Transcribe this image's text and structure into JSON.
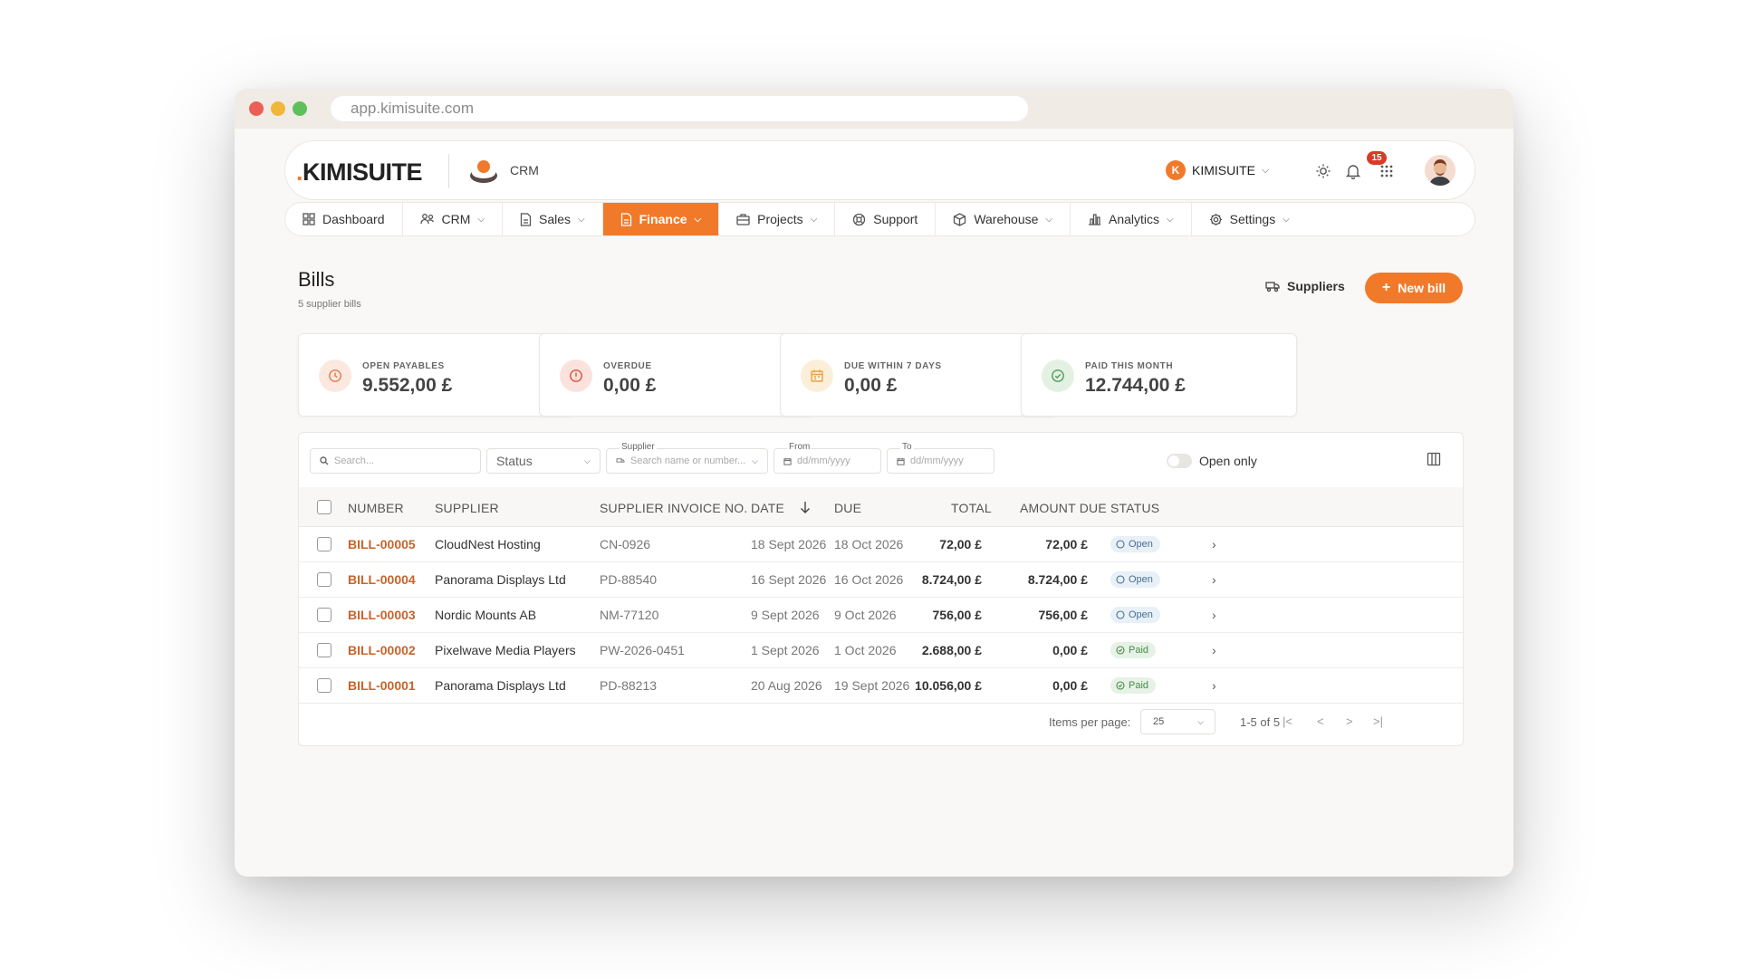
{
  "browser": {
    "url": "app.kimisuite.com"
  },
  "header": {
    "logo": "KIMISUITE",
    "module": "CRM",
    "tenant_initial": "K",
    "tenant": "KIMISUITE",
    "notifications_count": "15"
  },
  "nav": [
    {
      "label": "Dashboard",
      "icon": "dashboard-icon",
      "dropdown": false,
      "active": false
    },
    {
      "label": "CRM",
      "icon": "people-icon",
      "dropdown": true,
      "active": false
    },
    {
      "label": "Sales",
      "icon": "document-icon",
      "dropdown": true,
      "active": false
    },
    {
      "label": "Finance",
      "icon": "document-icon",
      "dropdown": true,
      "active": true
    },
    {
      "label": "Projects",
      "icon": "briefcase-icon",
      "dropdown": true,
      "active": false
    },
    {
      "label": "Support",
      "icon": "lifebuoy-icon",
      "dropdown": false,
      "active": false
    },
    {
      "label": "Warehouse",
      "icon": "box-icon",
      "dropdown": true,
      "active": false
    },
    {
      "label": "Analytics",
      "icon": "bar-chart-icon",
      "dropdown": true,
      "active": false
    },
    {
      "label": "Settings",
      "icon": "gear-icon",
      "dropdown": true,
      "active": false
    }
  ],
  "page": {
    "title": "Bills",
    "subtitle": "5 supplier bills",
    "suppliers_label": "Suppliers",
    "new_bill_label": "New bill"
  },
  "stats": [
    {
      "label": "OPEN PAYABLES",
      "value": "9.552,00 £",
      "icon": "clock-icon",
      "color": "#e5764a",
      "bg": "#fbe9df"
    },
    {
      "label": "OVERDUE",
      "value": "0,00 £",
      "icon": "alert-icon",
      "color": "#d9503c",
      "bg": "#fbe2dd"
    },
    {
      "label": "DUE WITHIN 7 DAYS",
      "value": "0,00 £",
      "icon": "calendar-icon",
      "color": "#e5a34a",
      "bg": "#fcefd9"
    },
    {
      "label": "PAID THIS MONTH",
      "value": "12.744,00 £",
      "icon": "check-circle-icon",
      "color": "#4f9a5a",
      "bg": "#e3f1e3"
    }
  ],
  "filters": {
    "search_placeholder": "Search...",
    "status_label": "Status",
    "supplier_label": "Supplier",
    "supplier_placeholder": "Search name or number...",
    "from_label": "From",
    "from_placeholder": "dd/mm/yyyy",
    "to_label": "To",
    "to_placeholder": "dd/mm/yyyy",
    "open_only_label": "Open only"
  },
  "columns": [
    "NUMBER",
    "SUPPLIER",
    "SUPPLIER INVOICE NO.",
    "DATE",
    "DUE",
    "TOTAL",
    "AMOUNT DUE",
    "STATUS"
  ],
  "rows": [
    {
      "number": "BILL-00005",
      "supplier": "CloudNest Hosting",
      "invoice": "CN-0926",
      "date": "18 Sept 2026",
      "due": "18 Oct 2026",
      "total": "72,00 £",
      "amount_due": "72,00 £",
      "status": "Open"
    },
    {
      "number": "BILL-00004",
      "supplier": "Panorama Displays Ltd",
      "invoice": "PD-88540",
      "date": "16 Sept 2026",
      "due": "16 Oct 2026",
      "total": "8.724,00 £",
      "amount_due": "8.724,00 £",
      "status": "Open"
    },
    {
      "number": "BILL-00003",
      "supplier": "Nordic Mounts AB",
      "invoice": "NM-77120",
      "date": "9 Sept 2026",
      "due": "9 Oct 2026",
      "total": "756,00 £",
      "amount_due": "756,00 £",
      "status": "Open"
    },
    {
      "number": "BILL-00002",
      "supplier": "Pixelwave Media Players",
      "invoice": "PW-2026-0451",
      "date": "1 Sept 2026",
      "due": "1 Oct 2026",
      "total": "2.688,00 £",
      "amount_due": "0,00 £",
      "status": "Paid"
    },
    {
      "number": "BILL-00001",
      "supplier": "Panorama Displays Ltd",
      "invoice": "PD-88213",
      "date": "20 Aug 2026",
      "due": "19 Sept 2026",
      "total": "10.056,00 £",
      "amount_due": "0,00 £",
      "status": "Paid"
    }
  ],
  "pager": {
    "items_per_page_label": "Items per page:",
    "items_per_page": "25",
    "range": "1-5 of 5"
  },
  "colors": {
    "accent": "#f07a2a",
    "link": "#c7642a"
  }
}
